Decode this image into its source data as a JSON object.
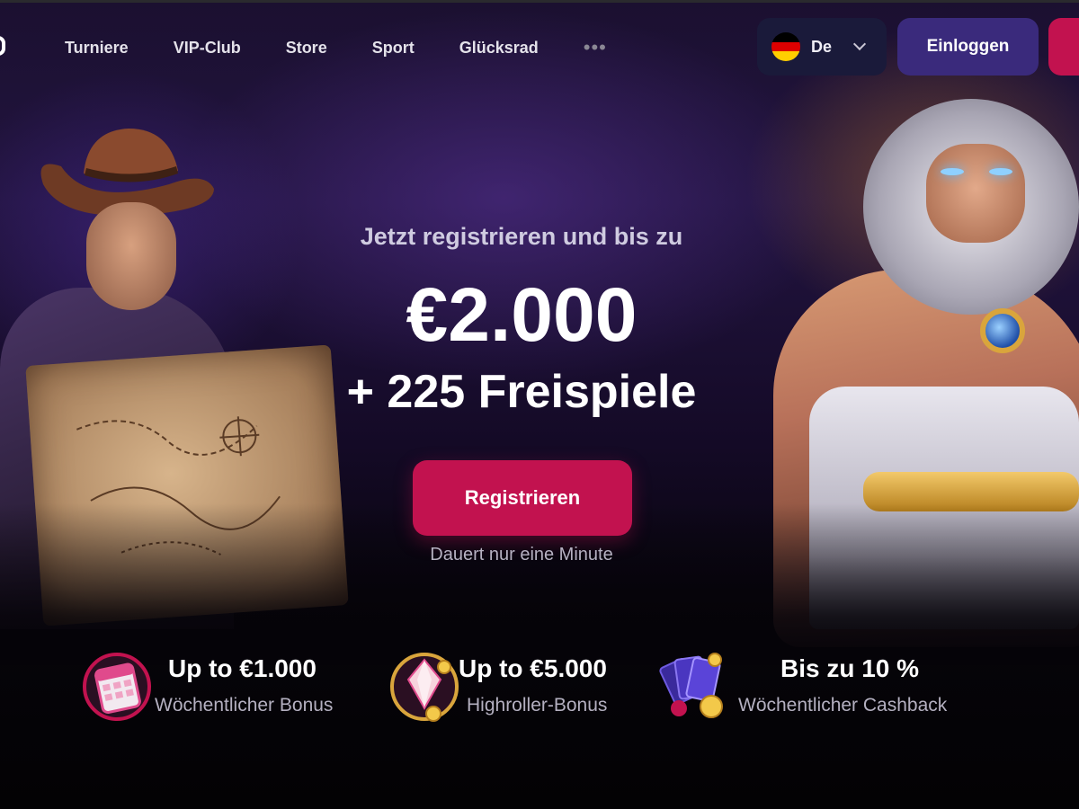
{
  "nav": {
    "items": [
      "Turniere",
      "VIP-Club",
      "Store",
      "Sport",
      "Glücksrad"
    ],
    "more": "•••"
  },
  "language": {
    "label": "De",
    "flag_colors": [
      "#000000",
      "#dd0000",
      "#ffce00"
    ]
  },
  "auth": {
    "login_label": "Einloggen"
  },
  "hero": {
    "subtitle": "Jetzt registrieren und bis zu",
    "amount": "€2.000",
    "spins": "+ 225 Freispiele",
    "register_label": "Registrieren",
    "hint": "Dauert nur eine Minute"
  },
  "features": [
    {
      "title": "Up to €1.000",
      "subtitle": "Wöchentlicher Bonus",
      "icon": "calendar-icon"
    },
    {
      "title": "Up to €5.000",
      "subtitle": "Highroller-Bonus",
      "icon": "crystal-coin-icon"
    },
    {
      "title": "Bis zu 10 %",
      "subtitle": "Wöchentlicher Cashback",
      "icon": "cards-coins-icon"
    }
  ],
  "colors": {
    "accent": "#c2124f",
    "login_bg": "#3a2a7c",
    "lang_bg": "#1a1a3a"
  }
}
